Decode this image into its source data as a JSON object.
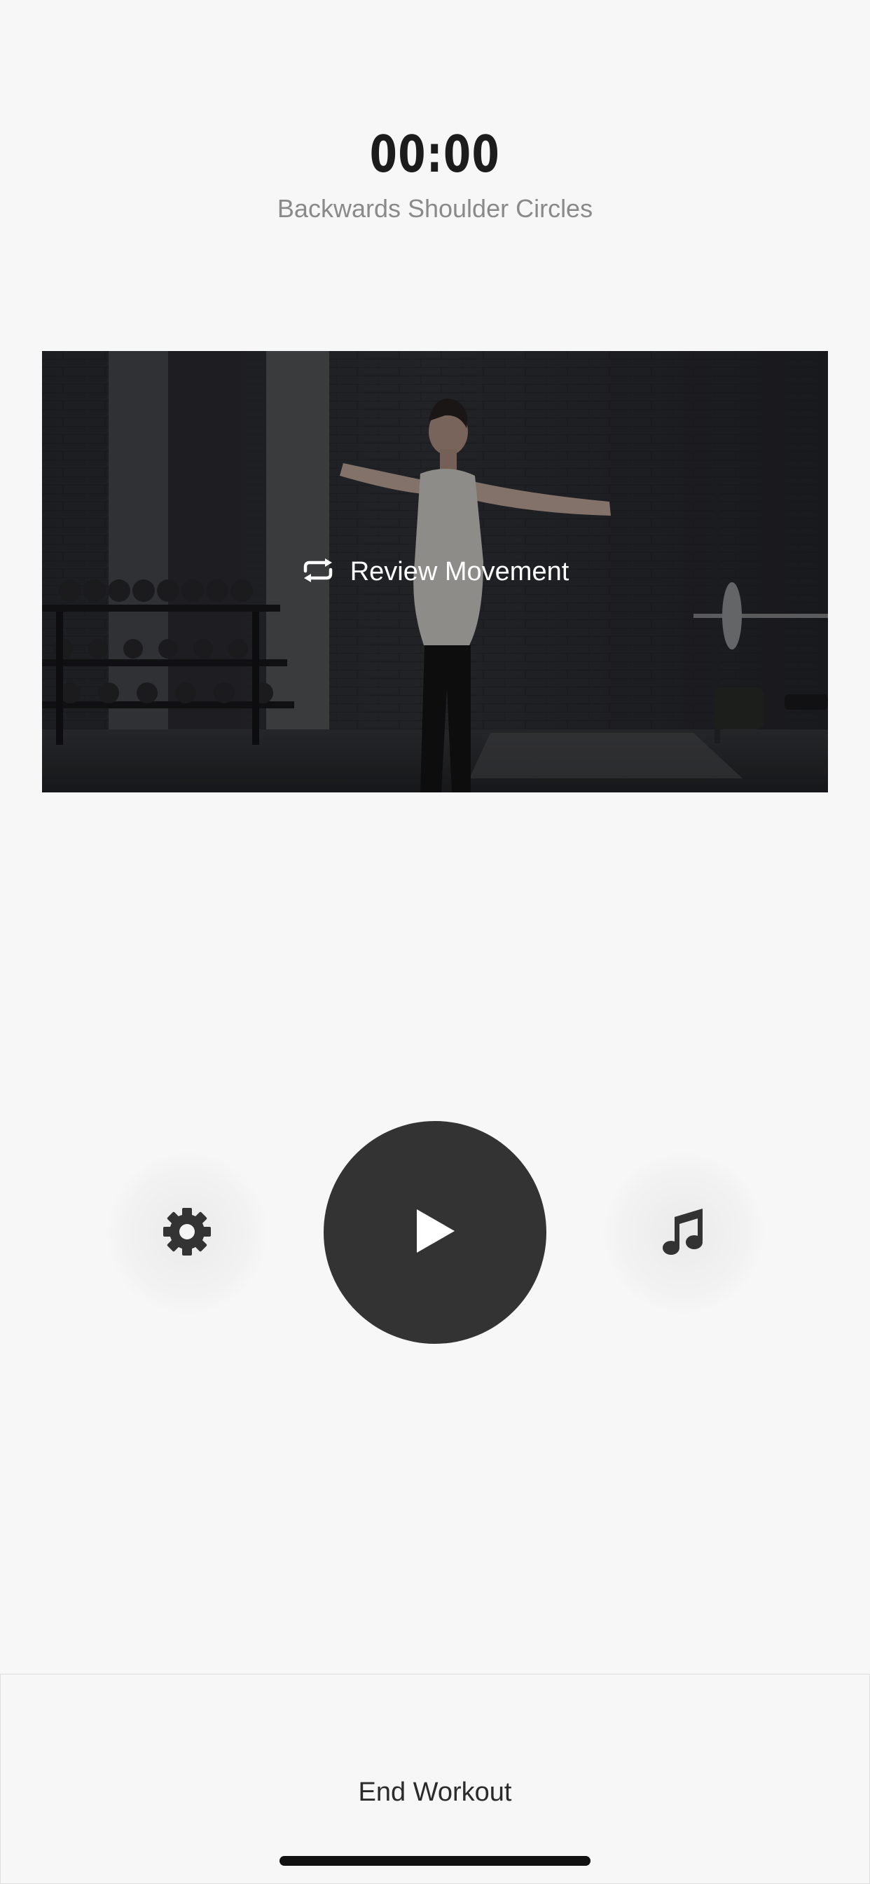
{
  "timer": {
    "value": "00:00"
  },
  "exercise": {
    "name": "Backwards Shoulder Circles"
  },
  "video": {
    "review_label": "Review Movement",
    "review_icon": "repeat-icon"
  },
  "controls": {
    "settings_icon": "gear-icon",
    "play_icon": "play-icon",
    "music_icon": "music-note-icon",
    "play_button_color": "#333333",
    "icon_color": "#333333"
  },
  "footer": {
    "end_label": "End Workout"
  },
  "colors": {
    "background": "#f7f7f7",
    "timer_text": "#1c1c1c",
    "subtitle_text": "#8a8a8a"
  }
}
